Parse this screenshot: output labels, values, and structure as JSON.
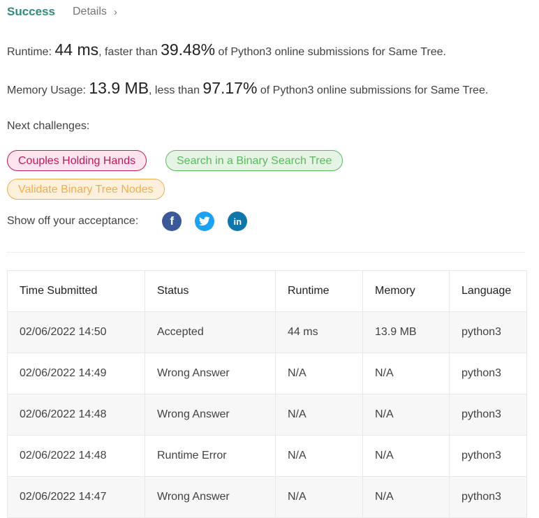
{
  "tabs": {
    "success": "Success",
    "details": "Details",
    "details_icon": "chevron-right-icon"
  },
  "runtime": {
    "label": "Runtime:",
    "value": "44 ms",
    "mid": ", faster than",
    "percent": "39.48%",
    "tail": "of Python3 online submissions for Same Tree."
  },
  "memory": {
    "label": "Memory Usage:",
    "value": "13.9 MB",
    "mid": ", less than",
    "percent": "97.17%",
    "tail": "of Python3 online submissions for Same Tree."
  },
  "next": {
    "label": "Next challenges:",
    "challenges": [
      {
        "title": "Couples Holding Hands",
        "difficulty_color": "#c2185b"
      },
      {
        "title": "Search in a Binary Search Tree",
        "difficulty_color": "#5cb85c"
      },
      {
        "title": "Validate Binary Tree Nodes",
        "difficulty_color": "#f0ad4e"
      }
    ]
  },
  "share": {
    "label": "Show off your acceptance:",
    "networks": [
      "facebook-icon",
      "twitter-icon",
      "linkedin-icon"
    ]
  },
  "table": {
    "headers": [
      "Time Submitted",
      "Status",
      "Runtime",
      "Memory",
      "Language"
    ],
    "rows": [
      {
        "time": "02/06/2022 14:50",
        "status": "Accepted",
        "runtime": "44 ms",
        "memory": "13.9 MB",
        "language": "python3"
      },
      {
        "time": "02/06/2022 14:49",
        "status": "Wrong Answer",
        "runtime": "N/A",
        "memory": "N/A",
        "language": "python3"
      },
      {
        "time": "02/06/2022 14:48",
        "status": "Wrong Answer",
        "runtime": "N/A",
        "memory": "N/A",
        "language": "python3"
      },
      {
        "time": "02/06/2022 14:48",
        "status": "Runtime Error",
        "runtime": "N/A",
        "memory": "N/A",
        "language": "python3"
      },
      {
        "time": "02/06/2022 14:47",
        "status": "Wrong Answer",
        "runtime": "N/A",
        "memory": "N/A",
        "language": "python3"
      }
    ]
  }
}
